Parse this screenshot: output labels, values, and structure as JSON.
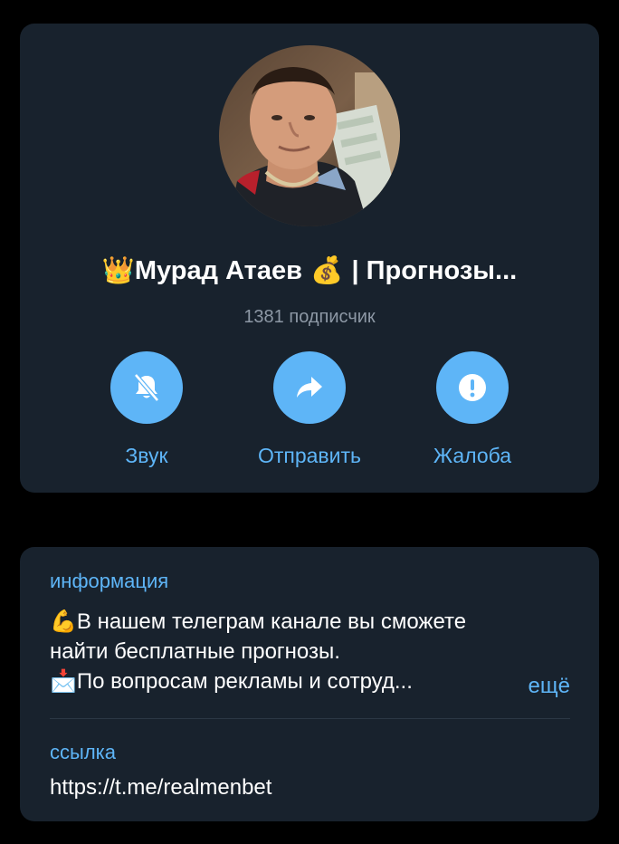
{
  "profile": {
    "title_prefix_icon": "crown-emoji",
    "title_name": "Мурад Атаев",
    "title_mid_icon": "money-bag-emoji",
    "title_suffix": "| Прогнозы...",
    "subscribers": "1381 подписчик",
    "actions": [
      {
        "label": "Звук",
        "icon": "bell-slash-icon"
      },
      {
        "label": "Отправить",
        "icon": "share-arrow-icon"
      },
      {
        "label": "Жалоба",
        "icon": "exclamation-icon"
      }
    ]
  },
  "info": {
    "label": "информация",
    "lines": [
      {
        "emoji": "💪",
        "text": "В нашем телеграм канале вы сможете"
      },
      {
        "emoji": "",
        "text": "найти бесплатные прогнозы."
      },
      {
        "emoji": "📩",
        "text": "По вопросам рекламы и сотруд..."
      }
    ],
    "more": "ещё"
  },
  "link": {
    "label": "ссылка",
    "value": "https://t.me/realmenbet"
  },
  "colors": {
    "background": "#000000",
    "card": "#18222d",
    "accent": "#5eb5f7",
    "muted_text": "#8d98a5",
    "text": "#ffffff"
  }
}
